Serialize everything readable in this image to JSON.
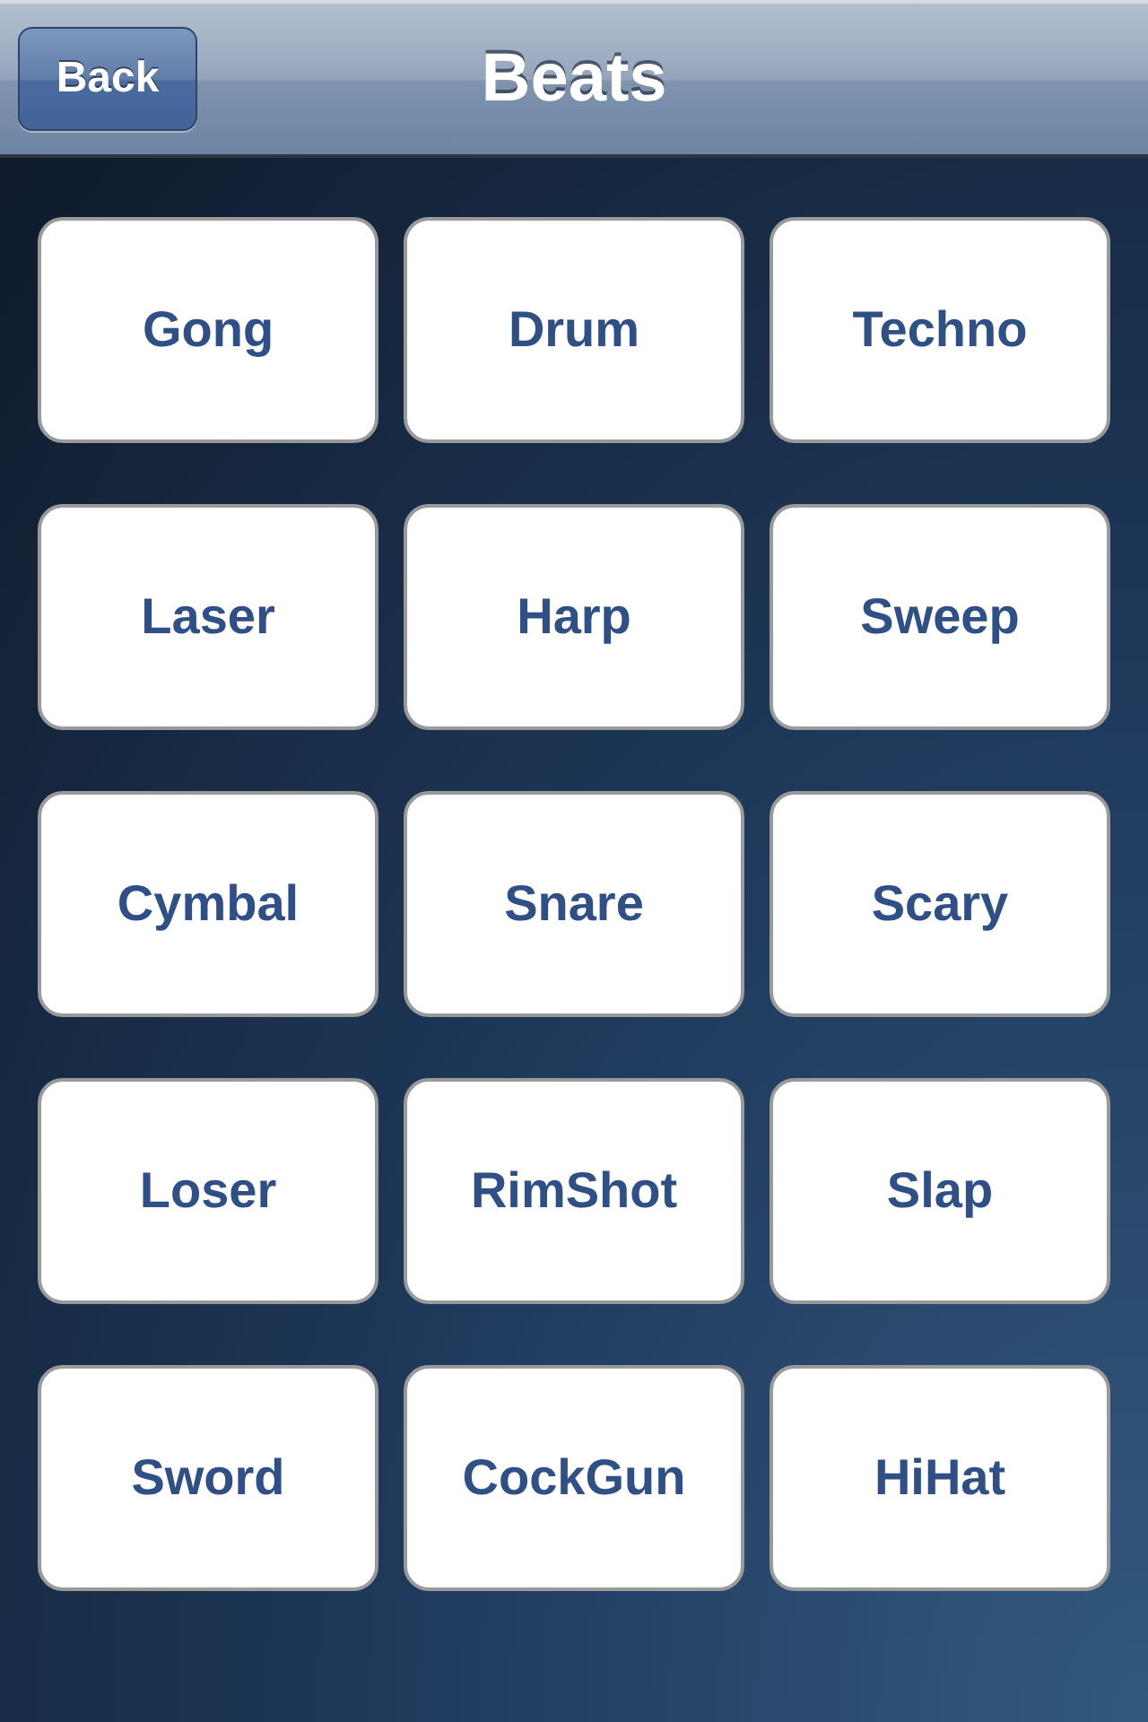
{
  "navigation_bar": {
    "back_button": "Back",
    "title": "Beats"
  },
  "beat_buttons": [
    {
      "label": "Gong"
    },
    {
      "label": "Drum"
    },
    {
      "label": "Techno"
    },
    {
      "label": "Laser"
    },
    {
      "label": "Harp"
    },
    {
      "label": "Sweep"
    },
    {
      "label": "Cymbal"
    },
    {
      "label": "Snare"
    },
    {
      "label": "Scary"
    },
    {
      "label": "Loser"
    },
    {
      "label": "RimShot"
    },
    {
      "label": "Slap"
    },
    {
      "label": "Sword"
    },
    {
      "label": "CockGun"
    },
    {
      "label": "HiHat"
    }
  ]
}
